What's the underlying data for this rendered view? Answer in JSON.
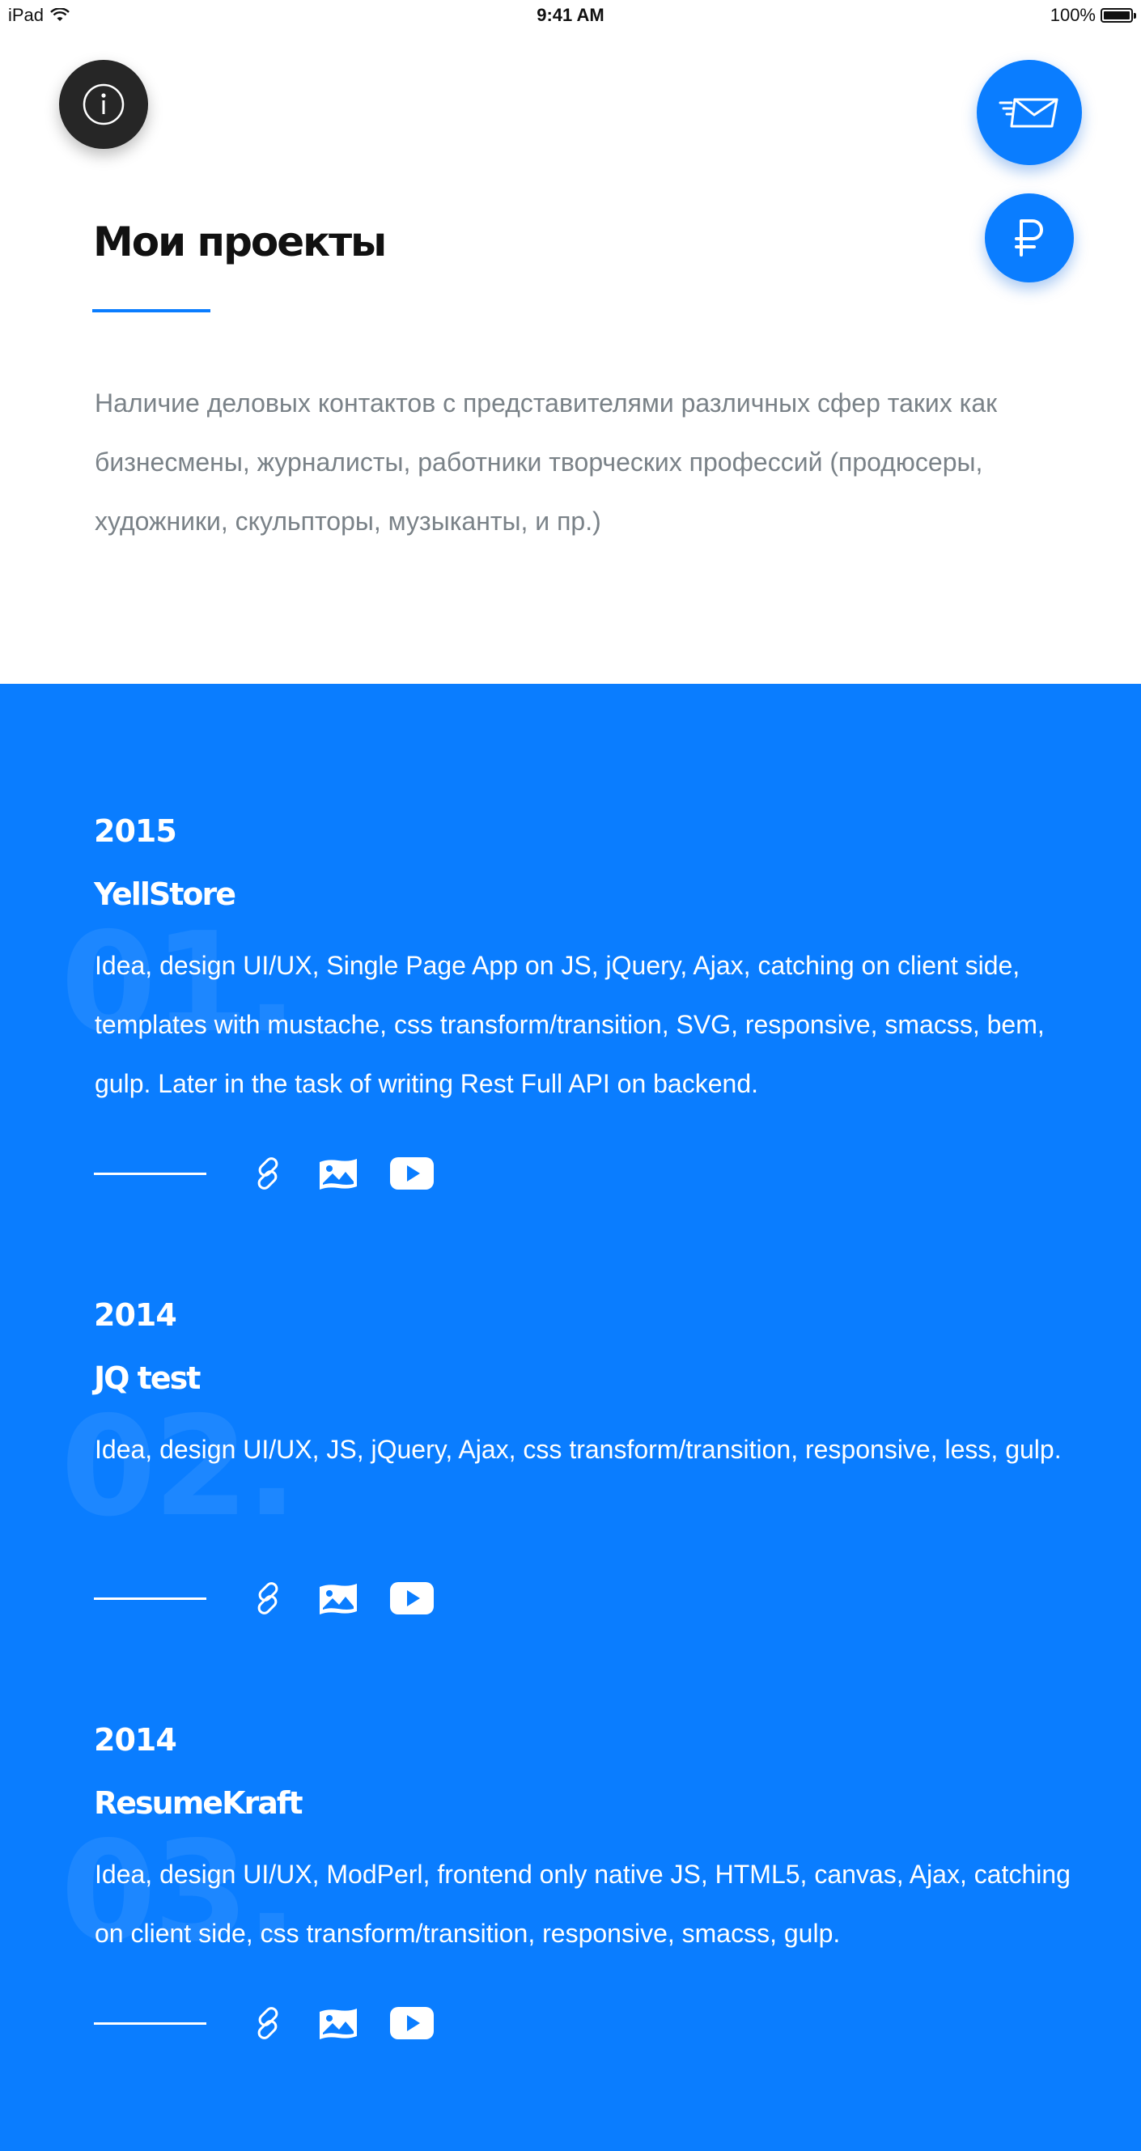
{
  "status_bar": {
    "device": "iPad",
    "time": "9:41 AM",
    "battery": "100%"
  },
  "header": {
    "title": "Мои проекты",
    "description": "Наличие деловых контактов с представителями различных сфер таких как бизнесмены, журналисты, работники творческих профессий (продюсеры, художники, скульпторы, музыканты, и пр.)"
  },
  "fab": {
    "info_icon": "info-icon",
    "mail_icon": "mail-icon",
    "ruble_icon": "ruble-icon"
  },
  "colors": {
    "accent": "#0a7dff",
    "dark_button": "#262626",
    "body_text": "#7a8288"
  },
  "projects": [
    {
      "number": "01.",
      "year": "2015",
      "name": "YellStore",
      "description": "Idea, design UI/UX, Single Page App on JS, jQuery, Ajax, catching on client side, templates with mustache, css transform/transition, SVG, responsive, smacss, bem, gulp. Later in the task of writing Rest Full API on backend.",
      "links": [
        "link-icon",
        "gallery-icon",
        "youtube-icon"
      ]
    },
    {
      "number": "02.",
      "year": "2014",
      "name": "JQ test",
      "description": "Idea, design UI/UX, JS, jQuery, Ajax, css transform/transition, responsive, less, gulp.",
      "links": [
        "link-icon",
        "gallery-icon",
        "youtube-icon"
      ]
    },
    {
      "number": "03.",
      "year": "2014",
      "name": "ResumeKraft",
      "description": "Idea, design UI/UX, ModPerl, frontend only native JS, HTML5, canvas, Ajax, catching on client side, css transform/transition, responsive, smacss, gulp.",
      "links": [
        "link-icon",
        "gallery-icon",
        "youtube-icon"
      ]
    }
  ]
}
